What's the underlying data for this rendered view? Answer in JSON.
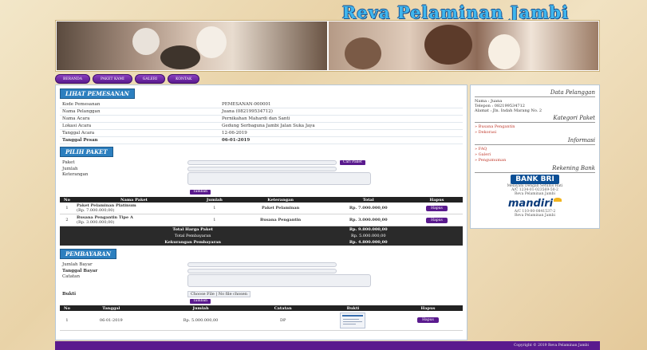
{
  "site": {
    "title": "Reva Pelaminan Jambi"
  },
  "nav": {
    "items": [
      "BERANDA",
      "PAKET KAMI",
      "GALERI",
      "KONTAK"
    ]
  },
  "lihat_pemesanan": {
    "heading": "LIHAT PEMESANAN",
    "rows": [
      {
        "label": "Kode Pemesanan",
        "value": "PEMESANAN-000001"
      },
      {
        "label": "Nama Pelanggan",
        "value": "Juana (082199534712)"
      },
      {
        "label": "Nama Acara",
        "value": "Pernikahan Mahardi dan Santi"
      },
      {
        "label": "Lokasi Acara",
        "value": "Gedung Serbaguna Jambi Jalan Suka Jaya"
      },
      {
        "label": "Tanggal Acara",
        "value": "12-06-2019"
      },
      {
        "label": "Tanggal Pesan",
        "value": "06-01-2019"
      }
    ]
  },
  "pilih_paket": {
    "heading": "PILIH PAKET",
    "fields": {
      "paket": "Paket",
      "jumlah": "Jumlah",
      "keterangan": "Keterangan"
    },
    "cari_button": "Cari Paket",
    "simpan_button": "Tambah",
    "table": {
      "headers": [
        "No",
        "Nama Paket",
        "Jumlah",
        "Keterangan",
        "Total",
        "Hapus"
      ],
      "rows": [
        {
          "no": "1",
          "nama": "Paket Pelaminan Platinum",
          "sub": "(Rp. 7.000.000,00)",
          "jumlah": "1",
          "ket": "Paket Pelaminan",
          "total": "Rp. 7.000.000,00",
          "aksi": "Hapus"
        },
        {
          "no": "2",
          "nama": "Busana Pengantin Tipe A",
          "sub": "(Rp. 3.000.000,00)",
          "jumlah": "1",
          "ket": "Busana Pengantin",
          "total": "Rp. 3.000.000,00",
          "aksi": "Hapus"
        }
      ],
      "summary": [
        {
          "label": "Total Harga Paket",
          "value": "Rp. 9.800.000,00"
        },
        {
          "label": "Total Pembayaran",
          "value": "Rp. 5.000.000,00"
        },
        {
          "label": "Kekurangan Pembayaran",
          "value": "Rp. 4.800.000,00"
        }
      ]
    }
  },
  "pembayaran": {
    "heading": "PEMBAYARAN",
    "fields": {
      "jumlah": "Jumlah Bayar",
      "tanggal": "Tanggal Bayar",
      "ket": "Catatan",
      "bukti": "Bukti"
    },
    "file_button": "Choose File",
    "file_status": "No file chosen",
    "simpan_button": "Tambah",
    "table": {
      "headers": [
        "No",
        "Tanggal",
        "Jumlah",
        "Catatan",
        "Bukti",
        "Hapus"
      ],
      "rows": [
        {
          "no": "1",
          "tanggal": "06-01-2019",
          "jumlah": "Rp. 5.000.000,00",
          "ket": "DP",
          "aksi": "Hapus"
        }
      ]
    }
  },
  "sidebar": {
    "data_pelanggan": {
      "heading": "Data Pelanggan",
      "lines": [
        "Nama : Juana",
        "Telepon : 082199534712",
        "Alamat : Jln. Indah Marang No. 2"
      ]
    },
    "kategori": {
      "heading": "Kategori Paket",
      "items": [
        "Busana Pengantin",
        "Dekorasi"
      ]
    },
    "informasi": {
      "heading": "Informasi",
      "items": [
        "FAQ",
        "Galeri",
        "Pengumuman"
      ]
    },
    "rekening": {
      "heading": "Rekening Bank",
      "bri": {
        "logo": "BANK BRI",
        "tagline": "Melayani Dengan Setulus Hati",
        "acct": "A/C 1234-01-023569-50-2",
        "name": "Reva Pelaminan Jambi"
      },
      "mandiri": {
        "logo": "mandiri",
        "acct": "A/C 110-00-0841537-2",
        "name": "Reva Pelaminan Jambi"
      }
    }
  },
  "footer": {
    "text": "Copyright © 2019 Reva Pelaminan Jambi"
  },
  "colors": {
    "accent": "#5a1a8e",
    "heading_blue": "#2c7fbf",
    "title_blue": "#3fb6ee"
  }
}
